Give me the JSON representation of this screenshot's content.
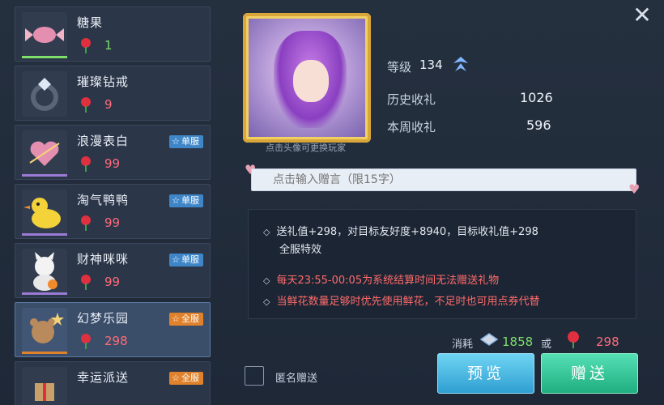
{
  "gifts": [
    {
      "name": "糖果",
      "cost": "1",
      "cost_color": "green",
      "badge": "",
      "underline": "#7dde6a",
      "icon": "candy-icon"
    },
    {
      "name": "璀璨钻戒",
      "cost": "9",
      "cost_color": "red",
      "badge": "",
      "underline": "",
      "icon": "diamond-ring-icon"
    },
    {
      "name": "浪漫表白",
      "cost": "99",
      "cost_color": "red",
      "badge": "单服",
      "badge_type": "single",
      "underline": "#9b7bd6",
      "icon": "cupid-icon"
    },
    {
      "name": "淘气鸭鸭",
      "cost": "99",
      "cost_color": "red",
      "badge": "单服",
      "badge_type": "single",
      "underline": "#9b7bd6",
      "icon": "duck-icon"
    },
    {
      "name": "财神咪咪",
      "cost": "99",
      "cost_color": "red",
      "badge": "单服",
      "badge_type": "single",
      "underline": "#9b7bd6",
      "icon": "fortune-cat-icon"
    },
    {
      "name": "幻梦乐园",
      "cost": "298",
      "cost_color": "red",
      "badge": "全服",
      "badge_type": "all",
      "underline": "#e0812c",
      "icon": "dream-bear-icon"
    },
    {
      "name": "幸运派送",
      "cost": "",
      "cost_color": "red",
      "badge": "全服",
      "badge_type": "all",
      "underline": "",
      "icon": "lucky-gift-icon"
    }
  ],
  "avatar": {
    "caption": "点击头像可更换玩家"
  },
  "stats": {
    "level_label": "等级",
    "level_value": "134",
    "history_label": "历史收礼",
    "history_value": "1026",
    "week_label": "本周收礼",
    "week_value": "596"
  },
  "message": {
    "placeholder": "点击输入赠言（限15字）"
  },
  "info": {
    "line1": "送礼值+298，对目标友好度+8940，目标收礼值+298",
    "line1b": "全服特效",
    "line2": "每天23:55-00:05为系统结算时间无法赠送礼物",
    "line3": "当鲜花数量足够时优先使用鲜花，不足时也可用点券代替"
  },
  "cost": {
    "label": "消耗",
    "coupon_value": "1858",
    "or_label": "或",
    "rose_value": "298"
  },
  "buttons": {
    "preview": "预览",
    "send": "赠送"
  },
  "anonymous": {
    "label": "匿名赠送"
  },
  "close": "✕",
  "colors": {
    "green": "#7dde6a",
    "red": "#ff6b7a",
    "single": "#3f86c9",
    "all": "#e0812c"
  }
}
